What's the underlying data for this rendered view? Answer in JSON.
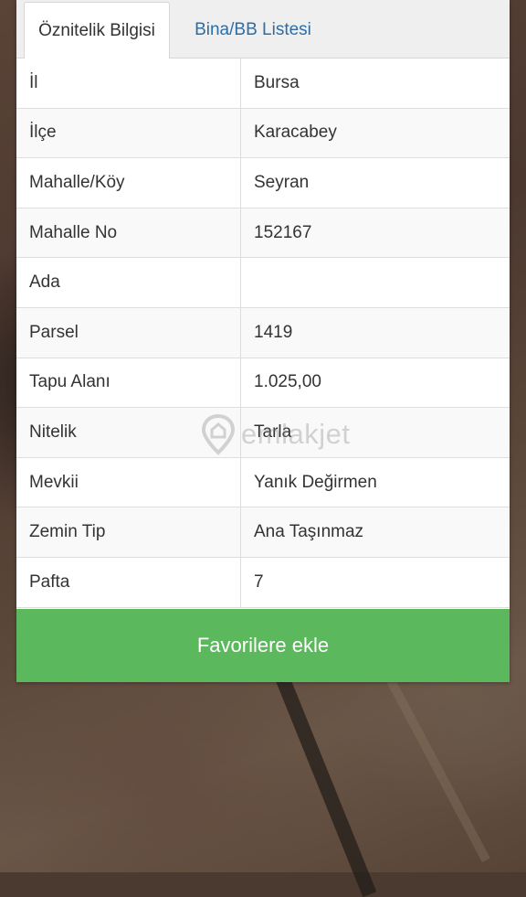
{
  "tabs": [
    {
      "label": "Öznitelik Bilgisi",
      "active": true
    },
    {
      "label": "Bina/BB Listesi",
      "active": false
    }
  ],
  "rows": [
    {
      "label": "İl",
      "value": "Bursa"
    },
    {
      "label": "İlçe",
      "value": "Karacabey"
    },
    {
      "label": "Mahalle/Köy",
      "value": "Seyran"
    },
    {
      "label": "Mahalle No",
      "value": "152167"
    },
    {
      "label": "Ada",
      "value": ""
    },
    {
      "label": "Parsel",
      "value": "1419"
    },
    {
      "label": "Tapu Alanı",
      "value": "1.025,00"
    },
    {
      "label": "Nitelik",
      "value": "Tarla"
    },
    {
      "label": "Mevkii",
      "value": "Yanık Değirmen"
    },
    {
      "label": "Zemin Tip",
      "value": "Ana Taşınmaz"
    },
    {
      "label": "Pafta",
      "value": "7"
    }
  ],
  "favorite_button": {
    "label": "Favorilere ekle"
  },
  "watermark": {
    "text": "emlakjet",
    "icon": "map-pin-logo"
  },
  "colors": {
    "button": "#5cb85c",
    "tab_link": "#2e6da4"
  }
}
